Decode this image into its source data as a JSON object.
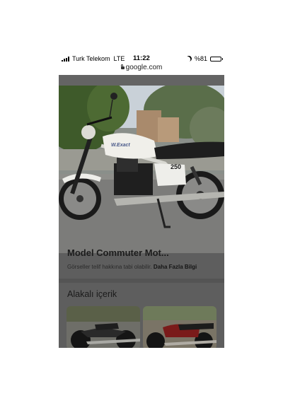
{
  "status_bar": {
    "carrier": "Turk Telekom",
    "network": "LTE",
    "time": "11:22",
    "battery_text": "%81",
    "battery_level": 0.81,
    "icons": [
      "signal-icon",
      "moon-icon",
      "battery-icon"
    ]
  },
  "address_bar": {
    "url": "google.com",
    "icon": "lock-icon"
  },
  "image_viewer": {
    "title_fragment": "Model Commuter Mot...",
    "license_text": "Görseller telif hakkına tabi olabilir.",
    "more_info_link": "Daha Fazla Bilgi",
    "photo_badge": "250",
    "photo_brand": "W.Exact"
  },
  "related": {
    "heading": "Alakalı içerik",
    "cards": [
      {
        "name": "related-card-1"
      },
      {
        "name": "related-card-2"
      }
    ]
  },
  "colors": {
    "overlay": "#5e5e5e",
    "tank": "#f0efea",
    "seat": "#1e1e1e"
  }
}
